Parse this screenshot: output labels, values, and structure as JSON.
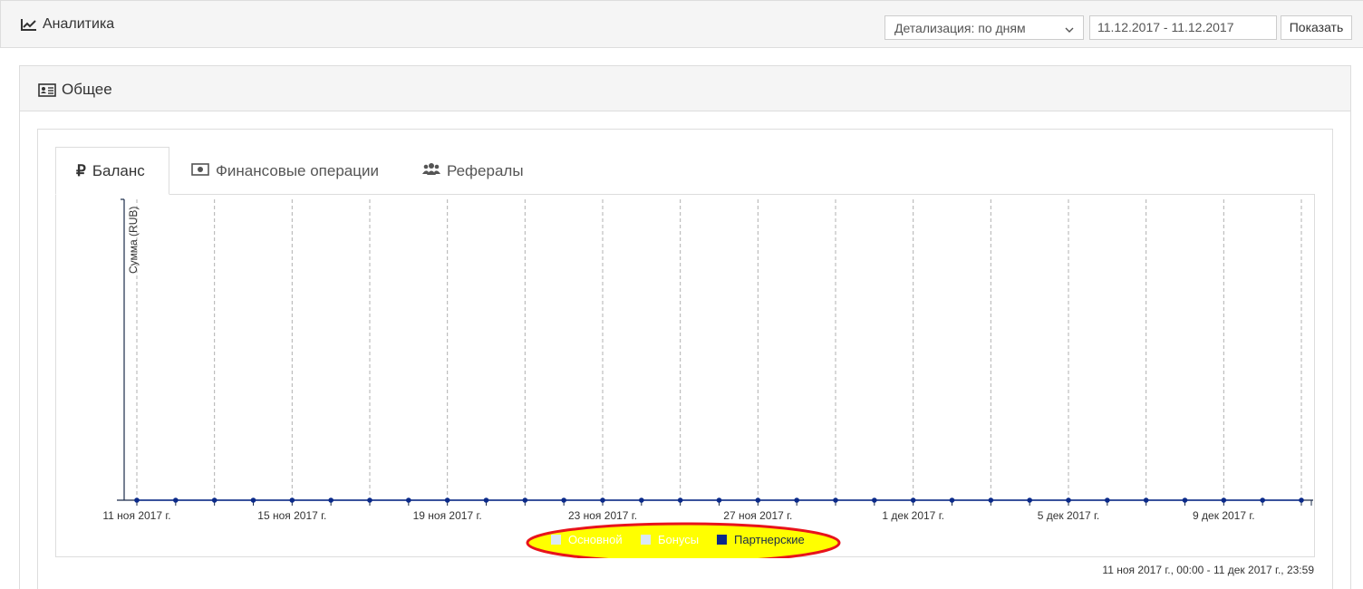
{
  "header": {
    "title": "Аналитика",
    "detail_select": "Детализация: по дням",
    "date_range": "11.12.2017 - 11.12.2017",
    "show_button": "Показать"
  },
  "panel": {
    "title": "Общее"
  },
  "tabs": [
    {
      "label": "Баланс",
      "icon": "ruble-icon",
      "active": true
    },
    {
      "label": "Финансовые операции",
      "icon": "money-icon",
      "active": false
    },
    {
      "label": "Рефералы",
      "icon": "users-icon",
      "active": false
    }
  ],
  "chart_data": {
    "type": "line",
    "ylabel": "Сумма (RUB)",
    "xlabel": "",
    "x_ticks": [
      "11 ноя 2017 г.",
      "15 ноя 2017 г.",
      "19 ноя 2017 г.",
      "23 ноя 2017 г.",
      "27 ноя 2017 г.",
      "1 дек 2017 г.",
      "5 дек 2017 г.",
      "9 дек 2017 г."
    ],
    "x": [
      "2017-11-11",
      "2017-11-12",
      "2017-11-13",
      "2017-11-14",
      "2017-11-15",
      "2017-11-16",
      "2017-11-17",
      "2017-11-18",
      "2017-11-19",
      "2017-11-20",
      "2017-11-21",
      "2017-11-22",
      "2017-11-23",
      "2017-11-24",
      "2017-11-25",
      "2017-11-26",
      "2017-11-27",
      "2017-11-28",
      "2017-11-29",
      "2017-11-30",
      "2017-12-01",
      "2017-12-02",
      "2017-12-03",
      "2017-12-04",
      "2017-12-05",
      "2017-12-06",
      "2017-12-07",
      "2017-12-08",
      "2017-12-09",
      "2017-12-10",
      "2017-12-11"
    ],
    "series": [
      {
        "name": "Основной",
        "color": "#dbe8f5",
        "visible": false,
        "values": []
      },
      {
        "name": "Бонусы",
        "color": "#dbe8f5",
        "visible": false,
        "values": []
      },
      {
        "name": "Партнерские",
        "color": "#0b2a8a",
        "visible": true,
        "values": [
          0,
          0,
          0,
          0,
          0,
          0,
          0,
          0,
          0,
          0,
          0,
          0,
          0,
          0,
          0,
          0,
          0,
          0,
          0,
          0,
          0,
          0,
          0,
          0,
          0,
          0,
          0,
          0,
          0,
          0,
          0
        ]
      }
    ],
    "legend": "bottom",
    "grid": "vertical-dashed"
  },
  "footer": {
    "range_text": "11 ноя 2017 г., 00:00 - 11 дек 2017 г., 23:59"
  },
  "colors": {
    "highlight_fill": "#ffff00",
    "highlight_stroke": "#e8131b",
    "axis": "#1a2b4a",
    "grid": "#b0b0b0"
  }
}
